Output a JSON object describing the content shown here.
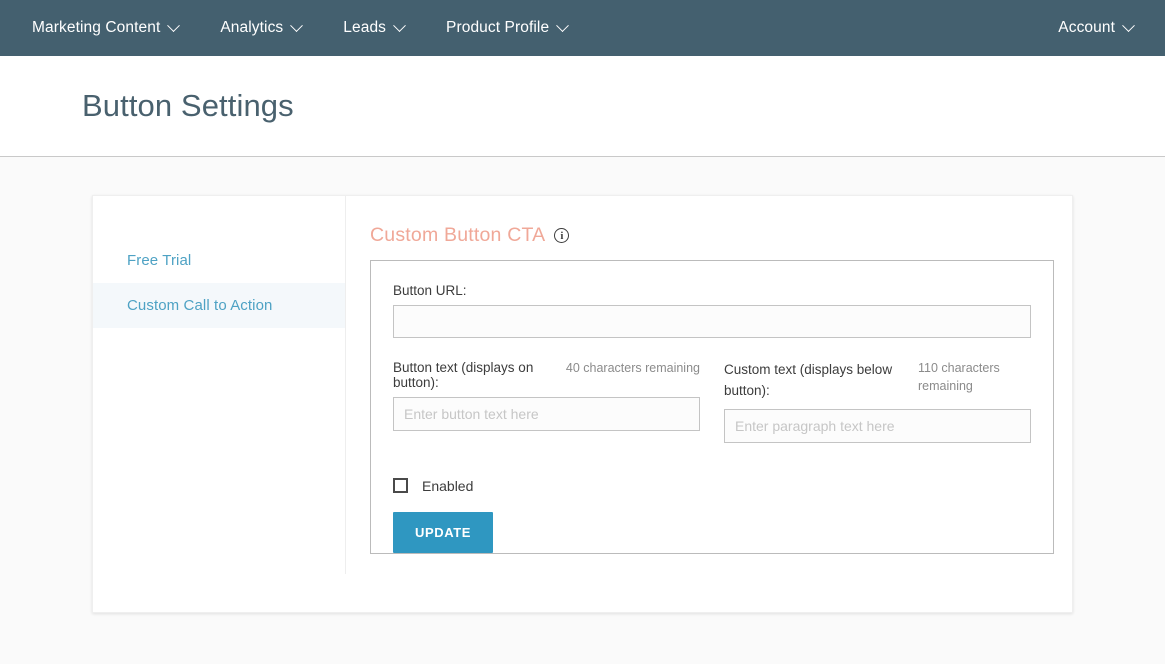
{
  "navbar": {
    "background": "#44606f",
    "items": [
      {
        "label": "Marketing Content",
        "icon": "chevron-down-icon"
      },
      {
        "label": "Analytics",
        "icon": "chevron-down-icon"
      },
      {
        "label": "Leads",
        "icon": "chevron-down-icon"
      },
      {
        "label": "Product Profile",
        "icon": "chevron-down-icon"
      }
    ],
    "account": {
      "label": "Account",
      "icon": "chevron-down-icon"
    }
  },
  "header": {
    "title": "Button Settings"
  },
  "sidebar": {
    "items": [
      {
        "label": "Free Trial",
        "active": false
      },
      {
        "label": "Custom Call to Action",
        "active": true
      }
    ],
    "active_color": "#4ea2c4"
  },
  "main": {
    "section_title": "Custom Button CTA",
    "section_title_color": "#f0a898",
    "info_icon": "info-icon",
    "info_glyph": "i",
    "fields": {
      "url": {
        "label": "Button URL:",
        "value": "",
        "placeholder": ""
      },
      "button_text": {
        "label": "Button text (displays on button):",
        "counter": "40 characters remaining",
        "value": "",
        "placeholder": "Enter button text here"
      },
      "custom_text": {
        "label": "Custom text (displays below button):",
        "counter": "110 characters remaining",
        "value": "",
        "placeholder": "Enter paragraph text here"
      }
    },
    "enabled_checkbox": {
      "label": "Enabled",
      "checked": false
    },
    "update_button": {
      "label": "UPDATE",
      "color": "#2f97c1"
    }
  }
}
